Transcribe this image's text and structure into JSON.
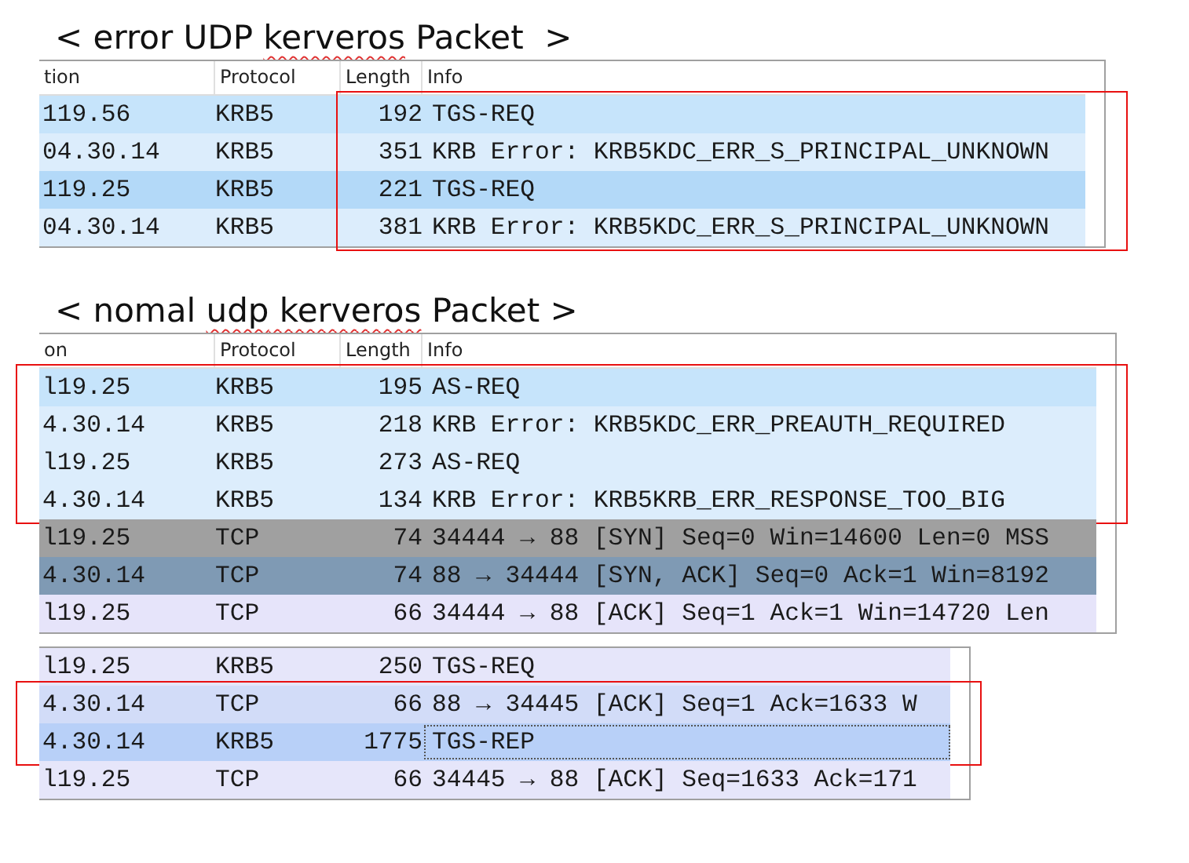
{
  "sections": [
    {
      "title": [
        {
          "text": "< error UDP ",
          "misspelled": false
        },
        {
          "text": "kerveros",
          "misspelled": true
        },
        {
          "text": " Packet  >",
          "misspelled": false
        }
      ],
      "box_covers_source": false,
      "columns": [
        "tion",
        "Protocol",
        "Length",
        "Info"
      ],
      "row_groups": [
        {
          "boxed": true,
          "rows": [
            {
              "source": "119.56",
              "protocol": "KRB5",
              "length": "192",
              "info": "TGS-REQ",
              "color": "#c6e4fb",
              "focused": false
            },
            {
              "source": "04.30.14",
              "protocol": "KRB5",
              "length": "351",
              "info": "KRB Error: KRB5KDC_ERR_S_PRINCIPAL_UNKNOWN",
              "color": "#dcedfc",
              "focused": false
            },
            {
              "source": "119.25",
              "protocol": "KRB5",
              "length": "221",
              "info": "TGS-REQ",
              "color": "#b3d9f8",
              "focused": false
            },
            {
              "source": "04.30.14",
              "protocol": "KRB5",
              "length": "381",
              "info": "KRB Error: KRB5KDC_ERR_S_PRINCIPAL_UNKNOWN",
              "color": "#dcedfc",
              "focused": false
            }
          ]
        }
      ]
    },
    {
      "title": [
        {
          "text": "< nomal ",
          "misspelled": false
        },
        {
          "text": "udp",
          "misspelled": true
        },
        {
          "text": " kerveros",
          "misspelled": true
        },
        {
          "text": " Packet >",
          "misspelled": false
        }
      ],
      "box_covers_source": true,
      "columns": [
        "on",
        "Protocol",
        "Length",
        "Info"
      ],
      "row_groups": [
        {
          "boxed": true,
          "rows": [
            {
              "source": "l19.25",
              "protocol": "KRB5",
              "length": "195",
              "info": "AS-REQ",
              "color": "#c6e4fb",
              "focused": false
            },
            {
              "source": "4.30.14",
              "protocol": "KRB5",
              "length": "218",
              "info": "KRB Error: KRB5KDC_ERR_PREAUTH_REQUIRED",
              "color": "#dcedfc",
              "focused": false
            },
            {
              "source": "l19.25",
              "protocol": "KRB5",
              "length": "273",
              "info": "AS-REQ",
              "color": "#dcedfc",
              "focused": false
            },
            {
              "source": "4.30.14",
              "protocol": "KRB5",
              "length": "134",
              "info": "KRB Error: KRB5KRB_ERR_RESPONSE_TOO_BIG",
              "color": "#dcedfc",
              "focused": false
            }
          ]
        },
        {
          "boxed": false,
          "rows": [
            {
              "source": "l19.25",
              "protocol": "TCP",
              "length": "74",
              "info": "34444 → 88 [SYN] Seq=0 Win=14600 Len=0 MSS",
              "color": "#a0a0a0",
              "focused": false
            },
            {
              "source": "4.30.14",
              "protocol": "TCP",
              "length": "74",
              "info": "88 → 34444 [SYN, ACK] Seq=0 Ack=1 Win=8192",
              "color": "#7f9ab4",
              "focused": false
            },
            {
              "source": "l19.25",
              "protocol": "TCP",
              "length": "66",
              "info": "34444 → 88 [ACK] Seq=1 Ack=1 Win=14720 Len",
              "color": "#e6e4fa",
              "focused": false
            }
          ]
        }
      ]
    },
    {
      "box_covers_source": true,
      "row_groups": [
        {
          "boxed": false,
          "rows": [
            {
              "source": "l19.25",
              "protocol": "KRB5",
              "length": "250",
              "info": "TGS-REQ",
              "color": "#e6e6fa",
              "focused": false
            }
          ]
        },
        {
          "boxed": true,
          "rows": [
            {
              "source": "4.30.14",
              "protocol": "TCP",
              "length": "66",
              "info": "88 → 34445 [ACK] Seq=1 Ack=1633 W",
              "color": "#d2dcf8",
              "focused": false
            },
            {
              "source": "4.30.14",
              "protocol": "KRB5",
              "length": "1775",
              "info": "TGS-REP",
              "color": "#b8d0f8",
              "focused": true
            }
          ]
        },
        {
          "boxed": false,
          "rows": [
            {
              "source": "l19.25",
              "protocol": "TCP",
              "length": "66",
              "info": "34445 → 88 [ACK] Seq=1633 Ack=171",
              "color": "#e6e6fa",
              "focused": false
            }
          ]
        }
      ]
    }
  ]
}
